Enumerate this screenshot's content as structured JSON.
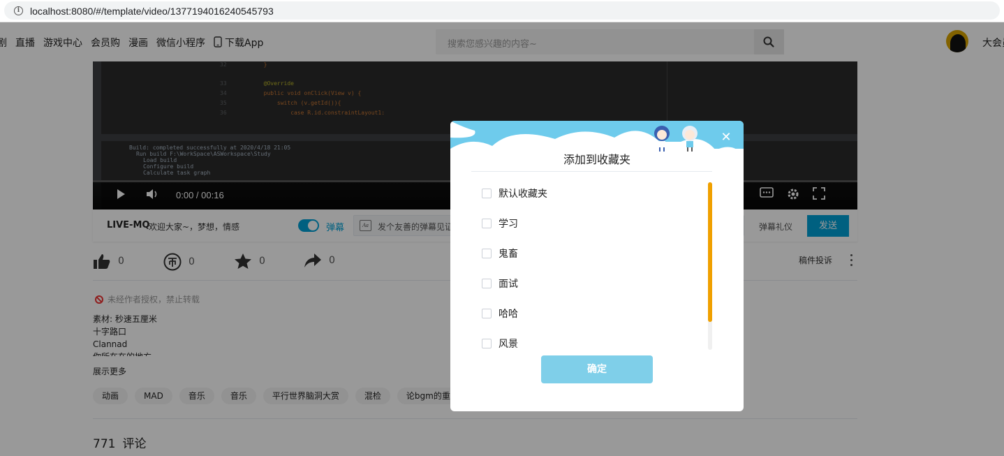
{
  "browser": {
    "url": "localhost:8080/#/template/video/1377194016240545793"
  },
  "header": {
    "nav": [
      "剧",
      "直播",
      "游戏中心",
      "会员购",
      "漫画",
      "微信小程序",
      "下载App"
    ],
    "search_placeholder": "搜索您感兴趣的内容~",
    "user_name": "大会员"
  },
  "player": {
    "time": "0:00 / 00:16",
    "code_lines": [
      {
        "num": "32",
        "text": "}"
      },
      {
        "num": "33",
        "text": "@Override"
      },
      {
        "num": "34",
        "text": "public void onClick(View v) {"
      },
      {
        "num": "35",
        "text": "switch (v.getId()){"
      },
      {
        "num": "36",
        "text": "case R.id.constraintLayout1:"
      }
    ],
    "build_lines": [
      "Build: completed successfully at 2020/4/18 21:05",
      "Run build F:\\WorkSpace\\ASWorkspace\\Study",
      "Load build",
      "Configure build",
      "Calculate task graph"
    ]
  },
  "danmaku": {
    "author": "LIVE-MQ",
    "description": "欢迎大家~，梦想，情感",
    "toggle_label": "弹幕",
    "input_placeholder": "发个友善的弹幕见证当下",
    "gift_label": "弹幕礼仪",
    "send_label": "发送"
  },
  "actions": {
    "like_count": "0",
    "coin_count": "0",
    "fav_count": "0",
    "share_count": "0",
    "report_label": "稿件投诉"
  },
  "video_info": {
    "notice": "未经作者授权，禁止转载",
    "desc_lines": [
      "素材: 秒速五厘米",
      "十字路口",
      "Clannad",
      "你所在在的地方"
    ],
    "show_more": "展示更多",
    "tags": [
      "动画",
      "MAD",
      "音乐",
      "音乐",
      "平行世界脑洞大赏",
      "混检",
      "论bgm的重要性"
    ]
  },
  "comments": {
    "count": "771",
    "label": "评论"
  },
  "modal": {
    "title": "添加到收藏夹",
    "folders": [
      "默认收藏夹",
      "学习",
      "鬼畜",
      "面试",
      "哈哈",
      "风景"
    ],
    "confirm_label": "确定",
    "scroll_position": 0.0
  },
  "colors": {
    "accent": "#00a1d6",
    "scrollbar": "#f0a000",
    "confirm": "#7fcfe9",
    "modal_header_sky": "#6ecbec"
  }
}
